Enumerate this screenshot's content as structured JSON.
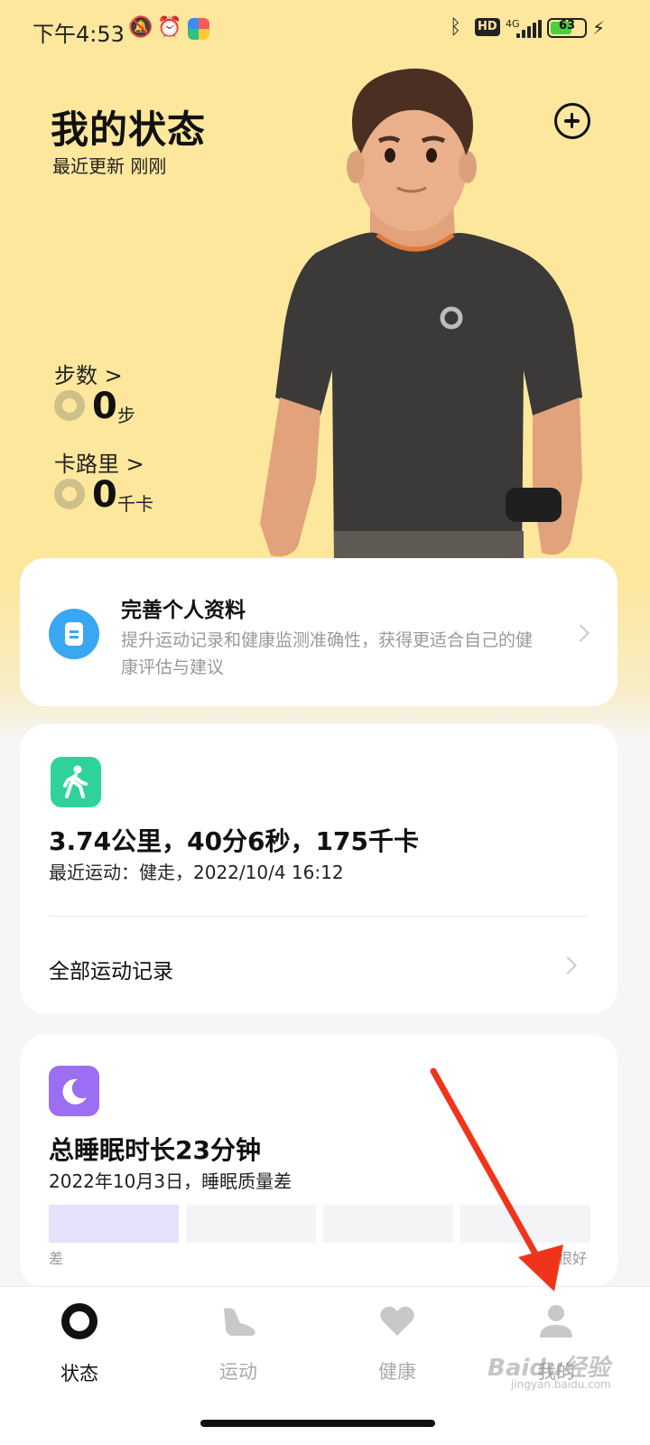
{
  "status_bar": {
    "time": "下午4:53",
    "network": "4G",
    "hd": "HD",
    "battery": "63",
    "battery_level": 0.63
  },
  "header": {
    "title": "我的状态",
    "updated": "最近更新 刚刚"
  },
  "stats": {
    "steps_label": "步数 >",
    "steps_value": "0",
    "steps_unit": "步",
    "calories_label": "卡路里 >",
    "calories_value": "0",
    "calories_unit": "千卡"
  },
  "profile_card": {
    "title": "完善个人资料",
    "description": "提升运动记录和健康监测准确性，获得更适合自己的健康评估与建议"
  },
  "sport_card": {
    "summary": "3.74公里，40分6秒，175千卡",
    "recent": "最近运动：健走，2022/10/4  16:12",
    "all_records": "全部运动记录"
  },
  "sleep_card": {
    "title": "总睡眠时长23分钟",
    "subtitle": "2022年10月3日，睡眠质量差",
    "scale_low": "差",
    "scale_high": "很好",
    "quality_level": 1,
    "quality_max": 4
  },
  "bottom_nav": {
    "items": [
      {
        "label": "状态",
        "icon": "status-ring-icon",
        "active": true
      },
      {
        "label": "运动",
        "icon": "shoe-icon",
        "active": false
      },
      {
        "label": "健康",
        "icon": "heart-icon",
        "active": false
      },
      {
        "label": "我的",
        "icon": "person-icon",
        "active": false
      }
    ]
  },
  "watermark": {
    "text": "Baidu经验",
    "sub": "jingyan.baidu.com"
  },
  "colors": {
    "header_bg": "#fde79d",
    "walk_icon": "#2fd39a",
    "moon_icon": "#9b6ef3",
    "profile_icon": "#3aa7f3",
    "annotation_arrow": "#f0341c"
  }
}
